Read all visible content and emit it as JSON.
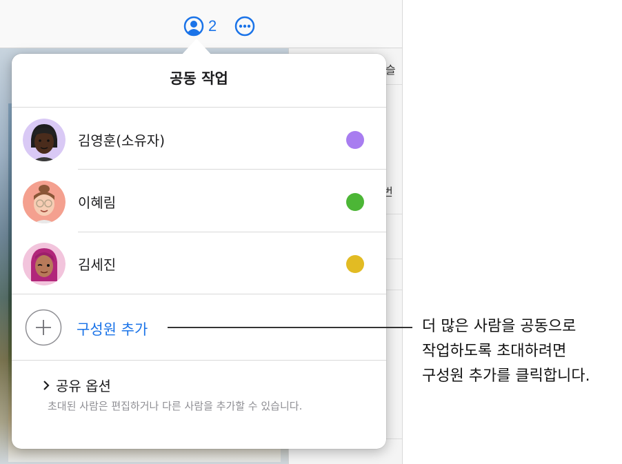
{
  "toolbar": {
    "collaborator_count": "2",
    "collab_icon": "person-circle-icon",
    "more_icon": "ellipsis-circle-icon",
    "accent": "#1a73e8"
  },
  "side_panel": {
    "text_top": "슬",
    "text_mid": ". 번"
  },
  "popover": {
    "title": "공동 작업",
    "participants": [
      {
        "name": "김영훈(소유자)",
        "color": "#a87df0",
        "avatar": "memoji-avatar-man-dreadlocks"
      },
      {
        "name": "이혜림",
        "color": "#4cb636",
        "avatar": "memoji-avatar-woman-glasses"
      },
      {
        "name": "김세진",
        "color": "#e2bb23",
        "avatar": "memoji-avatar-woman-pink-hair"
      }
    ],
    "add_member_label": "구성원 추가",
    "add_icon": "plus-circle-icon",
    "share_options_label": "공유 옵션",
    "share_options_desc": "초대된 사람은 편집하거나 다른 사람을 추가할 수 있습니다."
  },
  "callout": {
    "line1": "더 많은 사람을 공동으로",
    "line2": "작업하도록 초대하려면",
    "line3": "구성원 추가를 클릭합니다."
  }
}
